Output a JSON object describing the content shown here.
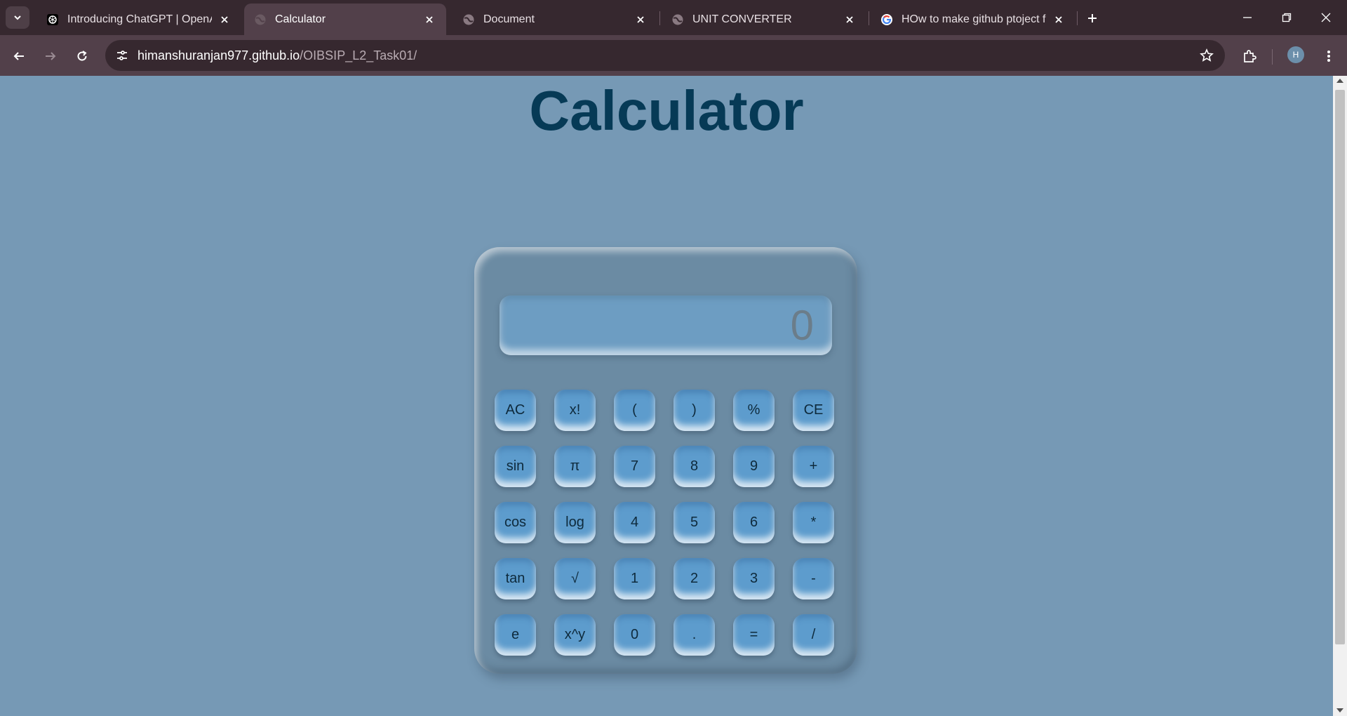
{
  "browser": {
    "tabs": [
      {
        "title": "Introducing ChatGPT | OpenAI",
        "icon": "openai-icon",
        "active": false
      },
      {
        "title": "Calculator",
        "icon": "globe-icon",
        "active": true
      },
      {
        "title": "Document",
        "icon": "globe-icon",
        "active": false
      },
      {
        "title": "UNIT CONVERTER",
        "icon": "globe-icon",
        "active": false
      },
      {
        "title": "HOw to make github ptoject fro",
        "icon": "google-icon",
        "active": false
      }
    ],
    "url_host": "himanshuranjan977.github.io",
    "url_path": "/OIBSIP_L2_Task01/",
    "profile_initial": "H"
  },
  "page": {
    "title": "Calculator"
  },
  "calculator": {
    "display_value": "0",
    "keys": [
      [
        "AC",
        "x!",
        "(",
        ")",
        "%",
        "CE"
      ],
      [
        "sin",
        "π",
        "7",
        "8",
        "9",
        "+"
      ],
      [
        "cos",
        "log",
        "4",
        "5",
        "6",
        "*"
      ],
      [
        "tan",
        "√",
        "1",
        "2",
        "3",
        "-"
      ],
      [
        "e",
        "x^y",
        "0",
        ".",
        "=",
        "/"
      ]
    ]
  },
  "colors": {
    "page_background": "#7699b5",
    "title": "#063a56",
    "calculator_body": "#6b8ba3",
    "key": "#5d9ccd",
    "display": "#6d9dc2"
  }
}
